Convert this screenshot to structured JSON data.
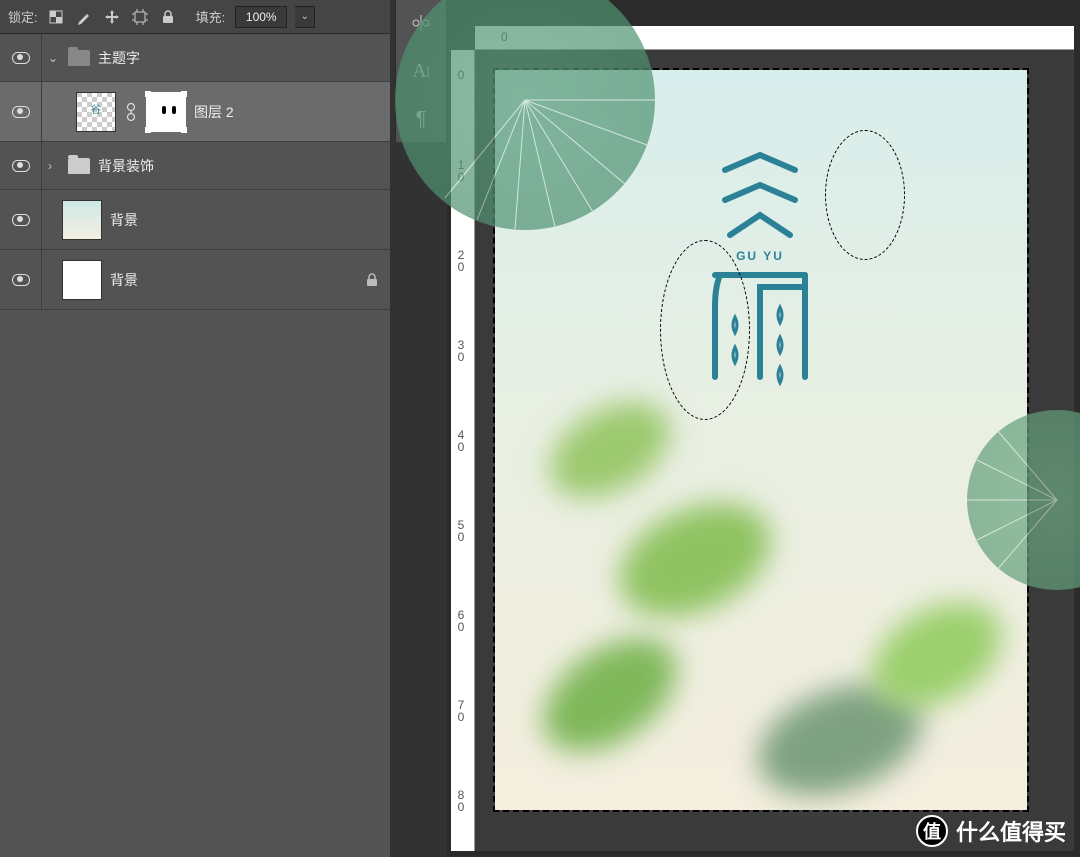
{
  "panel": {
    "lock_label": "锁定:",
    "fill_label": "填充:",
    "fill_value": "100%"
  },
  "layers": {
    "group1": "主题字",
    "layer1": "图层 2",
    "group2": "背景装饰",
    "bg1": "背景",
    "bg2": "背景"
  },
  "ruler_top": {
    "t0": "0"
  },
  "ruler_left": {
    "t0": "0",
    "t1": "10",
    "t2": "20",
    "t3": "30",
    "t4": "40",
    "t5": "50",
    "t6": "60",
    "t7": "70",
    "t8": "80"
  },
  "artwork": {
    "subtitle": "GU YU"
  },
  "watermark": {
    "char": "值",
    "text": "什么值得买"
  }
}
